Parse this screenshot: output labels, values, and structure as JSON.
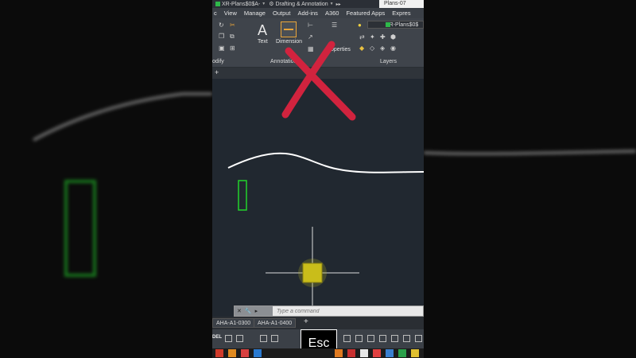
{
  "titlebar": {
    "file_label": "XR-Plans$0$A-",
    "workspace": "Drafting & Annotation",
    "right_tab": "Plans-07"
  },
  "menu_tabs": [
    "c",
    "View",
    "Manage",
    "Output",
    "Add-ins",
    "A360",
    "Featured Apps",
    "Expres"
  ],
  "ribbon": {
    "modify_label": "odify",
    "annotation_label": "Annotation",
    "layers_label": "Layers",
    "text_label": "Text",
    "dimension_label": "Dimension",
    "properties_label": "Properties",
    "layer_dropdown": "XR-Plans$0$"
  },
  "overlay": {
    "x_mark_color": "#d1233e"
  },
  "command_line": {
    "placeholder": "Type a command"
  },
  "layout_tabs": [
    "AHA-A1-0300",
    "AHA-A1-0400"
  ],
  "status_bar": {
    "model_label": "DEL"
  },
  "key_overlay": {
    "label": "Esc"
  },
  "colors": {
    "canvas_bg": "#212830",
    "rectangle": "#22d22b",
    "cursor_box": "#c9bd1a",
    "polyline": "#ffffff"
  }
}
